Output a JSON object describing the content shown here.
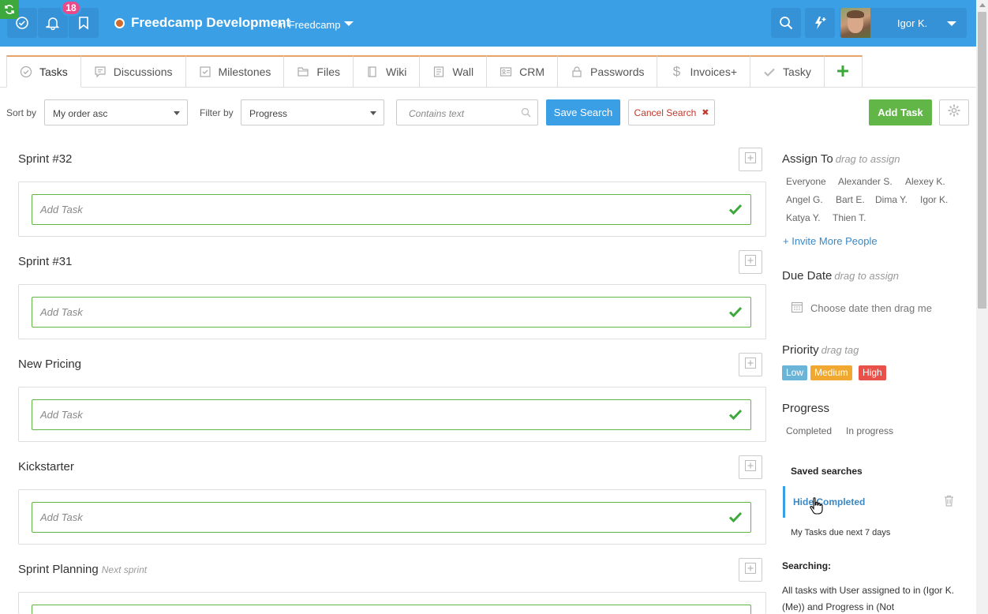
{
  "topbar": {
    "notifications_count": "18",
    "project_name": "Freedcamp Development",
    "project_sub": "in Freedcamp",
    "user_name": "Igor K.",
    "icons": [
      "sync-icon",
      "check-circle-icon",
      "bell-icon",
      "bookmark-icon",
      "search-icon",
      "lightning-icon",
      "chevron-down-icon"
    ],
    "colors": {
      "bar": "#3b9fe6",
      "badge": "#e84a8a",
      "project_dot": "#d06a2a"
    }
  },
  "tabs": [
    {
      "label": "Tasks",
      "icon": "check-circle-icon",
      "active": true
    },
    {
      "label": "Discussions",
      "icon": "comment-icon"
    },
    {
      "label": "Milestones",
      "icon": "checkbox-icon"
    },
    {
      "label": "Files",
      "icon": "folder-icon"
    },
    {
      "label": "Wiki",
      "icon": "book-icon"
    },
    {
      "label": "Wall",
      "icon": "document-icon"
    },
    {
      "label": "CRM",
      "icon": "contact-card-icon"
    },
    {
      "label": "Passwords",
      "icon": "lock-icon"
    },
    {
      "label": "Invoices+",
      "icon": "dollar-icon"
    },
    {
      "label": "Tasky",
      "icon": "checkmark-icon"
    }
  ],
  "filters": {
    "sort_label": "Sort by",
    "sort_value": "My order asc",
    "filter_label": "Filter by",
    "filter_value": "Progress",
    "text_placeholder": "Contains text",
    "save_search": "Save Search",
    "cancel_search": "Cancel Search",
    "add_task": "Add Task"
  },
  "lists": [
    {
      "title": "Sprint #32",
      "subtitle": "",
      "add_placeholder": "Add Task"
    },
    {
      "title": "Sprint #31",
      "subtitle": "",
      "add_placeholder": "Add Task"
    },
    {
      "title": "New Pricing",
      "subtitle": "",
      "add_placeholder": "Add Task"
    },
    {
      "title": "Kickstarter",
      "subtitle": "",
      "add_placeholder": "Add Task"
    },
    {
      "title": "Sprint Planning",
      "subtitle": "Next sprint",
      "add_placeholder": "Add Task"
    }
  ],
  "panel": {
    "assign_title": "Assign To",
    "assign_hint": "drag to assign",
    "people": [
      "Everyone",
      "Alexander S.",
      "Alexey K.",
      "Angel G.",
      "Bart E.",
      "Dima Y.",
      "Igor K.",
      "Katya Y.",
      "Thien T."
    ],
    "invite": "+ Invite More People",
    "due_title": "Due Date",
    "due_hint": "drag to assign",
    "due_text": "Choose date then drag me",
    "priority_title": "Priority",
    "priority_hint": "drag tag",
    "priorities": [
      {
        "label": "Low",
        "color": "#6ab4d8"
      },
      {
        "label": "Medium",
        "color": "#f0a830"
      },
      {
        "label": "High",
        "color": "#e8504a"
      }
    ],
    "progress_title": "Progress",
    "progress_options": [
      "Completed",
      "In progress"
    ],
    "saved_title": "Saved searches",
    "saved_items": [
      "Hide Completed",
      "My Tasks due next 7 days"
    ],
    "searching_title": "Searching:",
    "searching_text": "All tasks with User assigned to in (Igor K. (Me)) and Progress in (Not"
  }
}
